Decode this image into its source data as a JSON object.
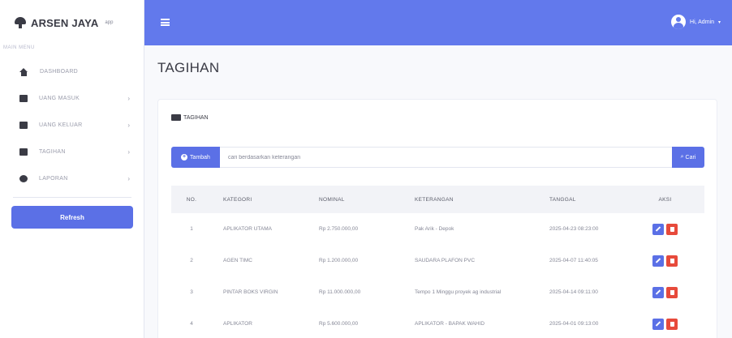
{
  "brand": {
    "title": "ARSEN JAYA",
    "subtitle": "app"
  },
  "sidebar": {
    "heading": "main menu",
    "items": [
      {
        "label": "DASHBOARD",
        "icon": "home-icon",
        "has_caret": false
      },
      {
        "label": "Uang Masuk",
        "icon": "table-icon",
        "has_caret": true
      },
      {
        "label": "Uang Keluar",
        "icon": "table-icon",
        "has_caret": true
      },
      {
        "label": "Tagihan",
        "icon": "table-icon",
        "has_caret": true
      },
      {
        "label": "Laporan",
        "icon": "report-icon",
        "has_caret": true
      }
    ],
    "refresh_label": "Refresh"
  },
  "topbar": {
    "user_name": "Hi, Admin"
  },
  "page": {
    "title": "TAGIHAN"
  },
  "card": {
    "title": "TAGIHAN",
    "add_label": "Tambah",
    "search_placeholder": "cari berdasarkan keterangan",
    "search_label": "Cari"
  },
  "table": {
    "headers": [
      "NO.",
      "KATEGORI",
      "NOMINAL",
      "KETERANGAN",
      "TANGGAL",
      "AKSI"
    ],
    "rows": [
      {
        "no": "1",
        "kategori": "APLIKATOR UTAMA",
        "nominal": "Rp 2.750.000,00",
        "keterangan": "Pak Arik - Depok",
        "tanggal": "2025-04-23 08:23:00"
      },
      {
        "no": "2",
        "kategori": "AGEN TIMC",
        "nominal": "Rp 1.200.000,00",
        "keterangan": "SAUDARA PLAFON PVC",
        "tanggal": "2025-04-07 11:40:05"
      },
      {
        "no": "3",
        "kategori": "PINTAR BOKS VIRGIN",
        "nominal": "Rp 11.000.000,00",
        "keterangan": "Tempo 1 Minggu proyek ag industrial",
        "tanggal": "2025-04-14 09:11:00"
      },
      {
        "no": "4",
        "kategori": "APLIKATOR",
        "nominal": "Rp 5.600.000,00",
        "keterangan": "APLIKATOR - BAPAK WAHID",
        "tanggal": "2025-04-01 09:13:00"
      }
    ]
  },
  "colors": {
    "primary": "#6279ec",
    "button": "#5b70e6",
    "danger": "#e74a3b"
  }
}
